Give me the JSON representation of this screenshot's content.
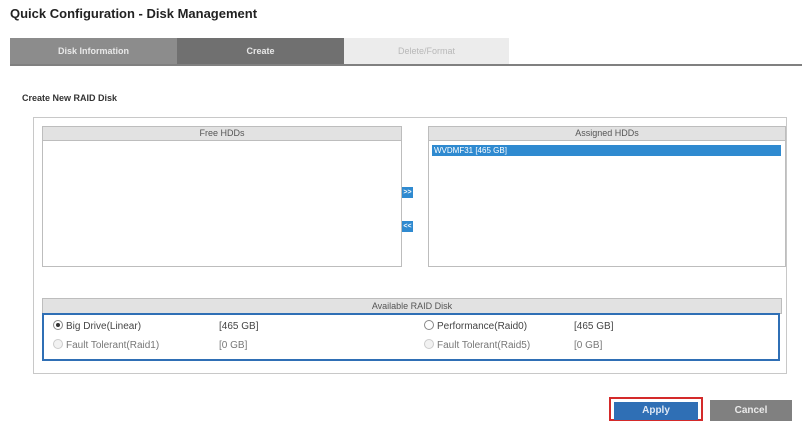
{
  "page": {
    "title": "Quick Configuration - Disk Management"
  },
  "tabs": [
    {
      "label": "Disk Information"
    },
    {
      "label": "Create"
    },
    {
      "label": "Delete/Format"
    }
  ],
  "section": {
    "title": "Create New RAID Disk"
  },
  "free_hdds": {
    "header": "Free HDDs",
    "items": []
  },
  "assigned_hdds": {
    "header": "Assigned HDDs",
    "items": [
      "WVDMF31 [465 GB]"
    ]
  },
  "move_buttons": {
    "add": ">>",
    "remove": "<<"
  },
  "raid": {
    "header": "Available RAID Disk",
    "options": [
      {
        "label": "Big Drive(Linear)",
        "size": "[465 GB]",
        "selected": true,
        "enabled": true
      },
      {
        "label": "Performance(Raid0)",
        "size": "[465 GB]",
        "selected": false,
        "enabled": true
      },
      {
        "label": "Fault Tolerant(Raid1)",
        "size": "[0 GB]",
        "selected": false,
        "enabled": false
      },
      {
        "label": "Fault Tolerant(Raid5)",
        "size": "[0 GB]",
        "selected": false,
        "enabled": false
      }
    ]
  },
  "buttons": {
    "apply": "Apply",
    "cancel": "Cancel"
  },
  "colors": {
    "accent": "#2f8ad0",
    "highlight": "#d42a2a",
    "tab_active": "#707070"
  }
}
